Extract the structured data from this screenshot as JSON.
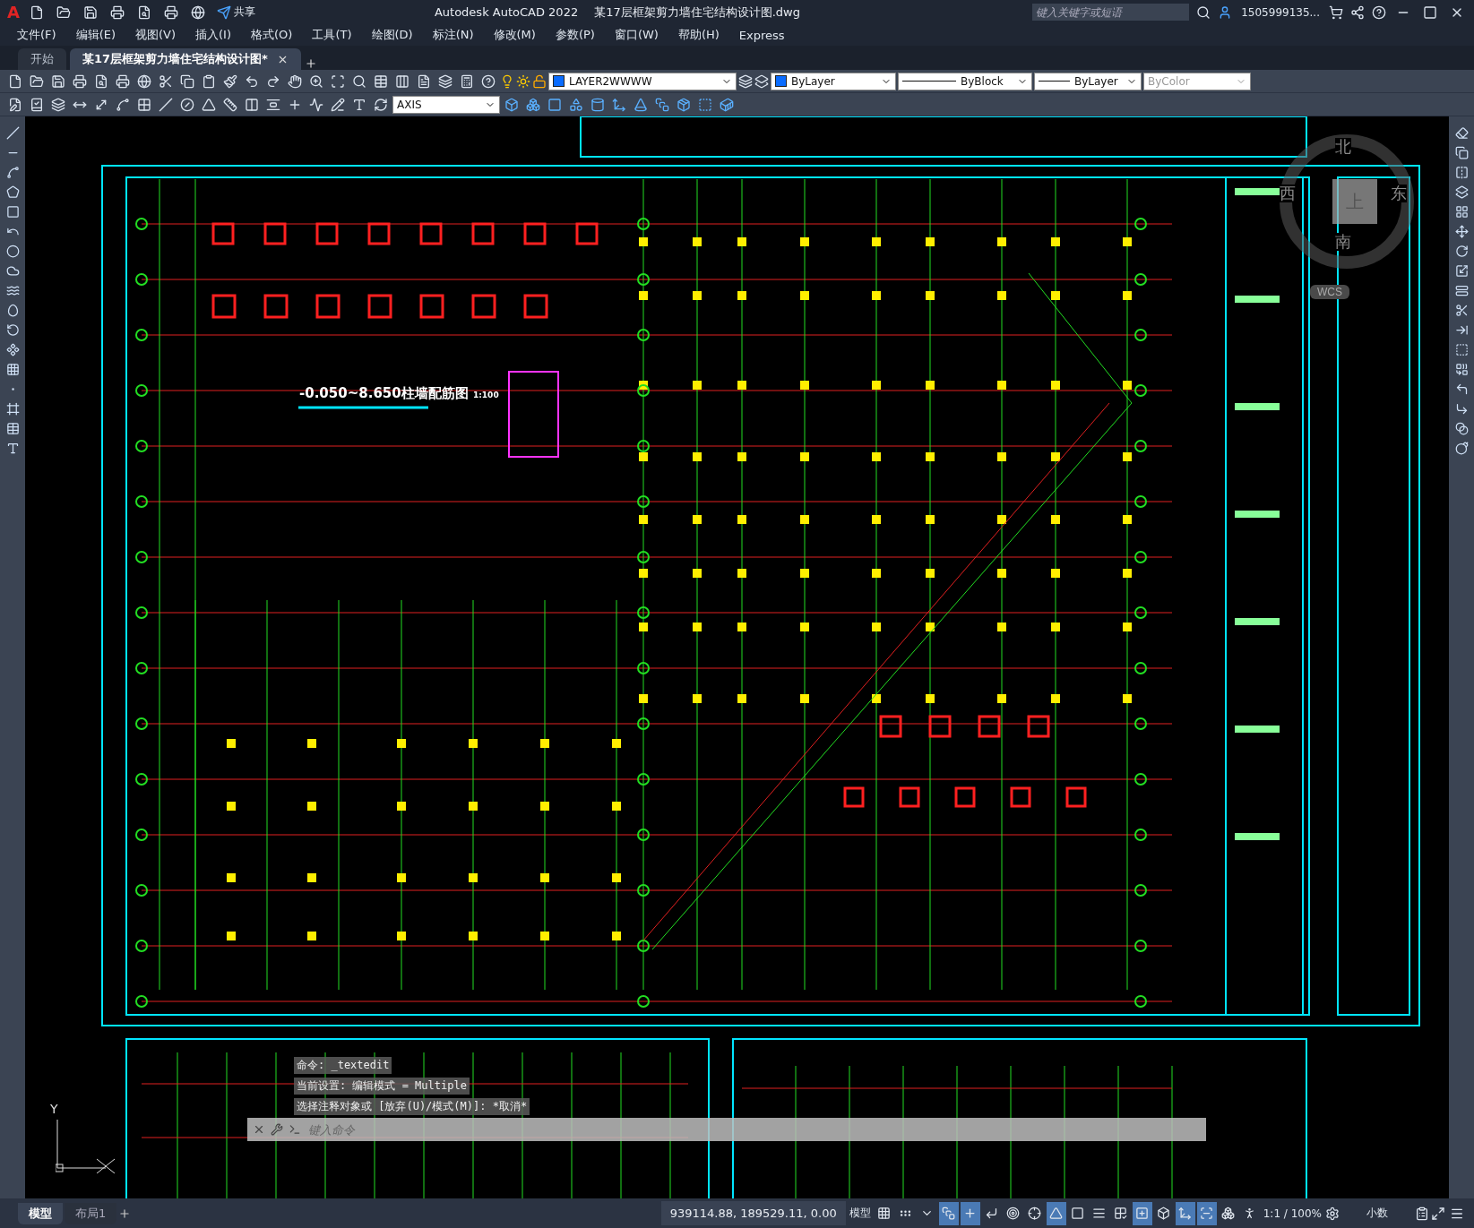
{
  "title_bar": {
    "logo": "A",
    "app_name": "Autodesk AutoCAD 2022",
    "file_name": "某17层框架剪力墙住宅结构设计图.dwg",
    "share": "共享",
    "search": {
      "placeholder": "键入关键字或短语"
    },
    "user": "1505999135..."
  },
  "menu": [
    "文件(F)",
    "编辑(E)",
    "视图(V)",
    "插入(I)",
    "格式(O)",
    "工具(T)",
    "绘图(D)",
    "标注(N)",
    "修改(M)",
    "参数(P)",
    "窗口(W)",
    "帮助(H)",
    "Express"
  ],
  "tabs": [
    {
      "label": "开始",
      "selected": false
    },
    {
      "label": "某17层框架剪力墙住宅结构设计图*",
      "selected": true
    }
  ],
  "toolbar": {
    "layer": "LAYER2WWWW",
    "color_control": "ByLayer",
    "linetype": "ByBlock",
    "lineweight": "ByLayer",
    "plot_style": "ByColor",
    "dim_style": "AXIS"
  },
  "drawing": {
    "title": "-0.050~8.650柱墙配筋图",
    "scale": "1:100"
  },
  "viewcube": {
    "north": "北",
    "east": "东",
    "south": "南",
    "west": "西",
    "top": "上",
    "ucs": "WCS"
  },
  "ucs_axes": {
    "y": "Y"
  },
  "command_history": [
    "命令:  _textedit",
    "当前设置: 编辑模式 = Multiple",
    "选择注释对象或 [放弃(U)/模式(M)]: *取消*"
  ],
  "command_line": {
    "placeholder": "键入命令"
  },
  "layout_tabs": [
    {
      "label": "模型",
      "selected": true
    },
    {
      "label": "布局1",
      "selected": false
    }
  ],
  "status_bar": {
    "coordinates": "939114.88, 189529.11, 0.00",
    "space": "模型",
    "scale": "1:1 / 100%",
    "units": "小数",
    "toggles": [
      {
        "on": false
      },
      {
        "on": false
      },
      {
        "on": false
      },
      {
        "on": true
      },
      {
        "on": true
      },
      {
        "on": false
      },
      {
        "on": false
      },
      {
        "on": false
      },
      {
        "on": true
      },
      {
        "on": false
      },
      {
        "on": false
      },
      {
        "on": false
      },
      {
        "on": true
      },
      {
        "on": false
      },
      {
        "on": true
      },
      {
        "on": true
      },
      {
        "on": false
      },
      {
        "on": false
      }
    ]
  }
}
